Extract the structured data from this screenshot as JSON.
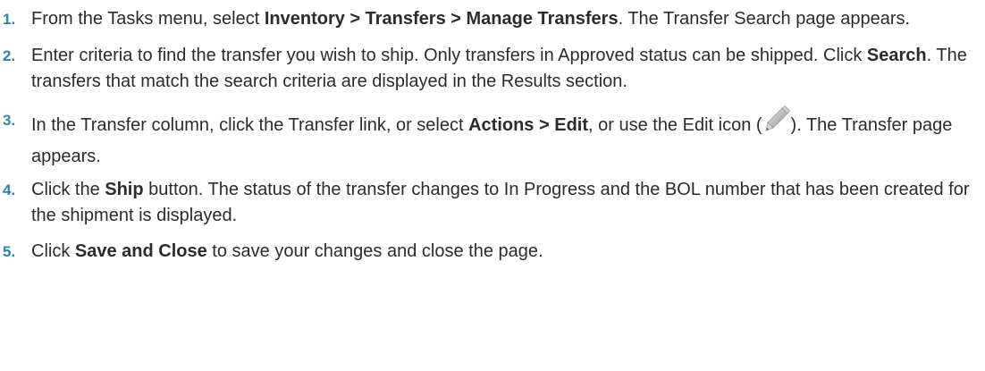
{
  "steps": [
    {
      "number": "1.",
      "t1": "From the Tasks menu, select ",
      "b1": "Inventory > Transfers > Manage Transfers",
      "t2": ". The Transfer Search page appears."
    },
    {
      "number": "2.",
      "t1": "Enter criteria to find the transfer you wish to ship. Only transfers in Approved status can be shipped. Click ",
      "b1": "Search",
      "t2": ". The transfers that match the search criteria are displayed in the Results section."
    },
    {
      "number": "3.",
      "t1": "In the Transfer column, click the Transfer link, or select ",
      "b1": "Actions > Edit",
      "t2": ", or use the Edit icon (",
      "icon": "pencil-edit-icon",
      "t3": "). The Transfer page appears."
    },
    {
      "number": "4.",
      "t1": "Click the ",
      "b1": "Ship",
      "t2": " button. The status of the transfer changes to In Progress and the BOL number that has been created for the shipment is displayed."
    },
    {
      "number": "5.",
      "t1": "Click ",
      "b1": "Save and Close",
      "t2": " to save your changes and close the page."
    }
  ],
  "colors": {
    "step_number": "#2f7fb0",
    "body_text": "#2b2b2b"
  }
}
